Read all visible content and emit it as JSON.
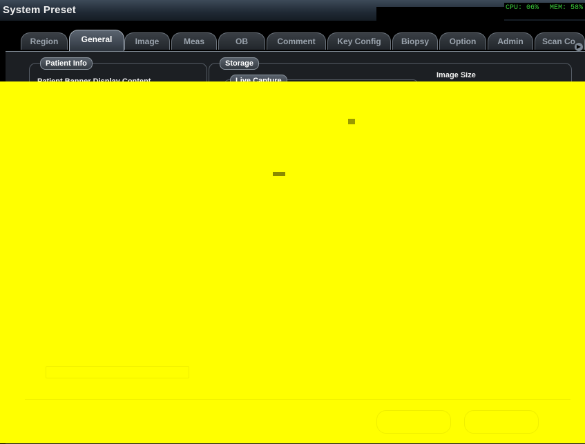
{
  "window": {
    "title": "System Preset",
    "cpu": "CPU: 06%",
    "mem": "MEM: 58%"
  },
  "tabs": [
    {
      "label": "Region",
      "active": false
    },
    {
      "label": "General",
      "active": true
    },
    {
      "label": "Image",
      "active": false
    },
    {
      "label": "Meas",
      "active": false
    },
    {
      "label": "OB",
      "active": false
    },
    {
      "label": "Comment",
      "active": false
    },
    {
      "label": "Key Config",
      "active": false
    },
    {
      "label": "Biopsy",
      "active": false
    },
    {
      "label": "Option",
      "active": false
    },
    {
      "label": "Admin",
      "active": false
    },
    {
      "label": "Scan Co"
    }
  ],
  "patient_info": {
    "legend": "Patient Info",
    "banner_label": "Patient Banner Display Content"
  },
  "storage": {
    "legend": "Storage",
    "live_capture_legend": "Live Capture",
    "image_size_label": "Image Size"
  },
  "colors": {
    "accent_yellow": "#ffff00",
    "status_green": "#3ccf3c"
  }
}
